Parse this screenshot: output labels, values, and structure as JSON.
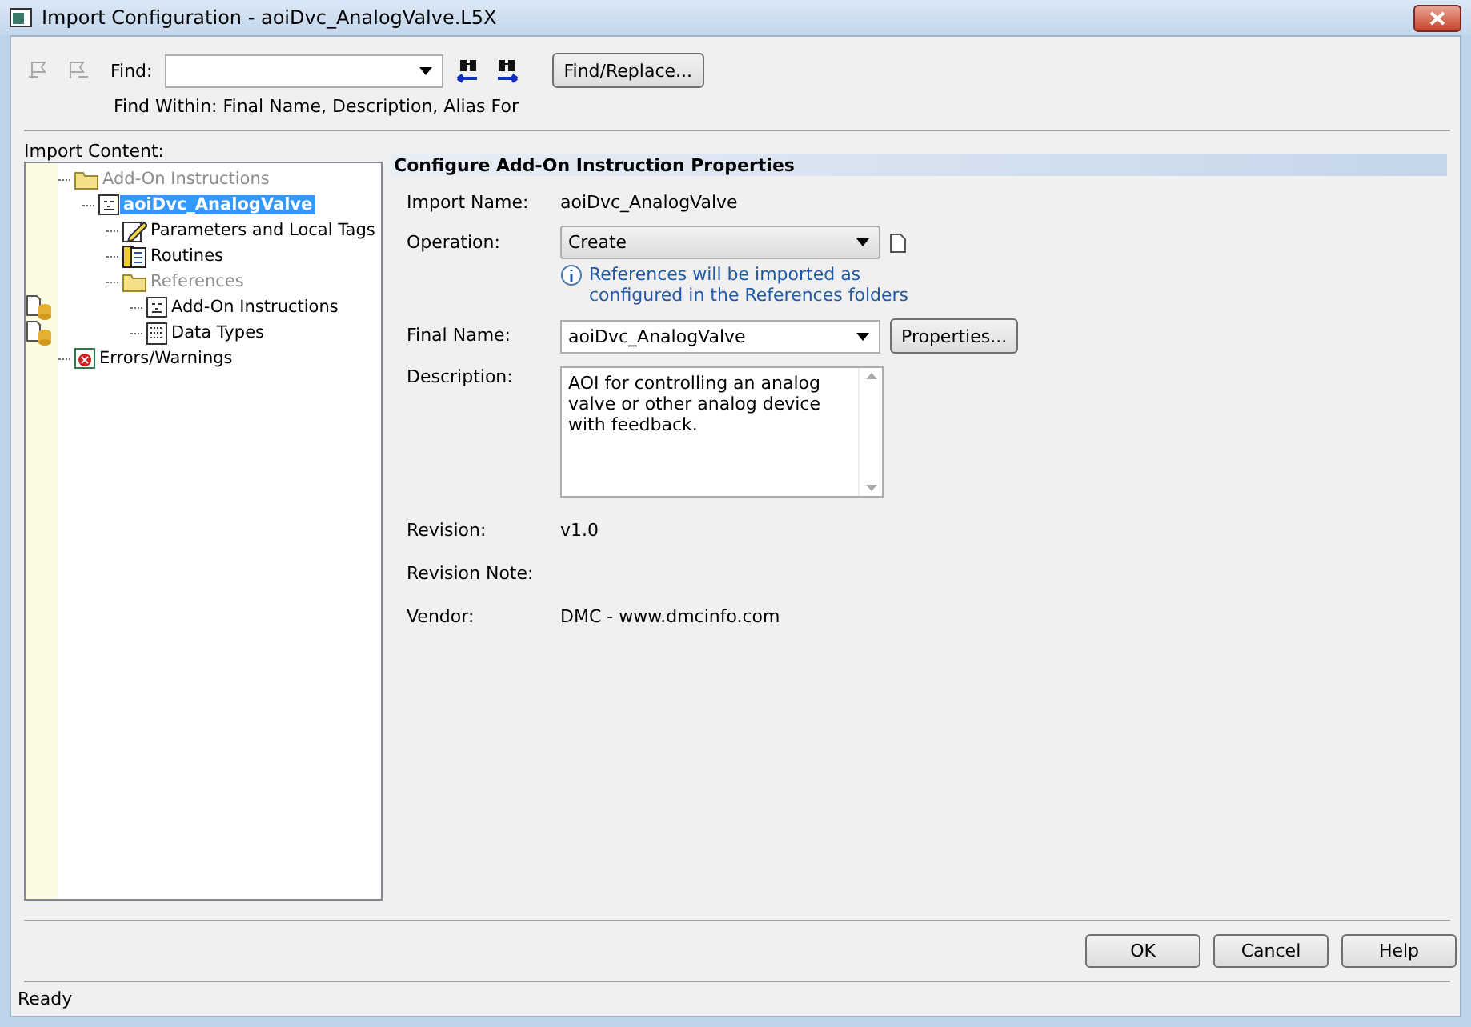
{
  "window": {
    "title": "Import Configuration - aoiDvc_AnalogValve.L5X"
  },
  "find": {
    "label": "Find:",
    "within": "Find Within: Final Name, Description, Alias For",
    "button": "Find/Replace..."
  },
  "import_content": {
    "label": "Import Content:",
    "tree": [
      {
        "label": "Add-On Instructions",
        "kind": "folder",
        "disabled": true,
        "selected": false,
        "children": [
          {
            "label": "aoiDvc_AnalogValve",
            "kind": "instruction",
            "disabled": false,
            "selected": true,
            "children": [
              {
                "label": "Parameters and Local Tags",
                "kind": "tags",
                "disabled": false,
                "selected": false
              },
              {
                "label": "Routines",
                "kind": "routines",
                "disabled": false,
                "selected": false
              },
              {
                "label": "References",
                "kind": "folder",
                "disabled": true,
                "selected": false,
                "children": [
                  {
                    "label": "Add-On Instructions",
                    "kind": "refinstruction",
                    "disabled": false,
                    "selected": false
                  },
                  {
                    "label": "Data Types",
                    "kind": "refdatatypes",
                    "disabled": false,
                    "selected": false
                  }
                ]
              }
            ]
          }
        ]
      },
      {
        "label": "Errors/Warnings",
        "kind": "errors",
        "disabled": false,
        "selected": false
      }
    ]
  },
  "properties": {
    "title": "Configure Add-On Instruction Properties",
    "import_name": {
      "label": "Import Name:",
      "value": "aoiDvc_AnalogValve"
    },
    "operation": {
      "label": "Operation:",
      "value": "Create",
      "info": "References will be imported as configured in the References folders"
    },
    "final_name": {
      "label": "Final Name:",
      "value": "aoiDvc_AnalogValve",
      "button": "Properties..."
    },
    "description": {
      "label": "Description:",
      "value": "AOI for controlling an analog valve or other analog device with feedback."
    },
    "revision": {
      "label": "Revision:",
      "value": "v1.0"
    },
    "revision_note": {
      "label": "Revision Note:"
    },
    "vendor": {
      "label": "Vendor:",
      "value": "DMC - www.dmcinfo.com"
    }
  },
  "buttons": [
    "OK",
    "Cancel",
    "Help"
  ],
  "status_bar": "Ready"
}
